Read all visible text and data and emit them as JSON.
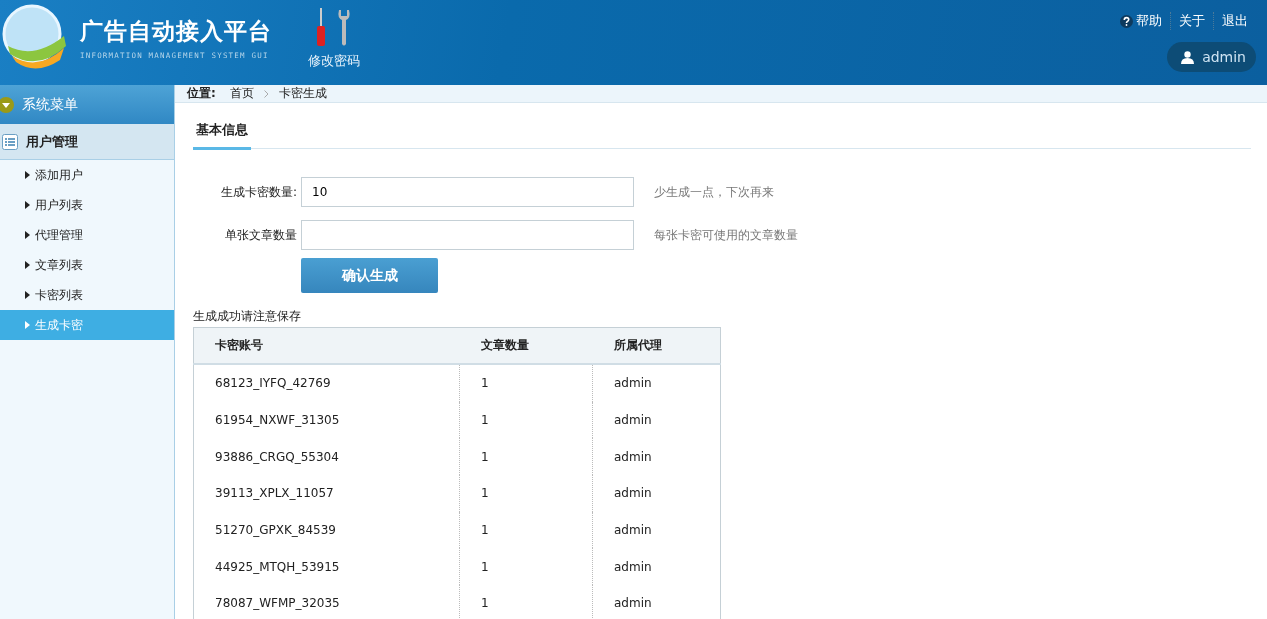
{
  "header": {
    "title": "广告自动接入平台",
    "subtitle": "INFORMATION MANAGEMENT SYSTEM GUI",
    "tool": {
      "label": "修改密码"
    },
    "links": [
      {
        "kind": "help",
        "label": "帮助"
      },
      {
        "kind": "plain",
        "label": "关于"
      },
      {
        "kind": "plain",
        "label": "退出"
      }
    ],
    "user": "admin"
  },
  "sidebar": {
    "title": "系统菜单",
    "group": {
      "label": "用户管理",
      "items": [
        {
          "label": "添加用户",
          "selected": false
        },
        {
          "label": "用户列表",
          "selected": false
        },
        {
          "label": "代理管理",
          "selected": false
        },
        {
          "label": "文章列表",
          "selected": false
        },
        {
          "label": "卡密列表",
          "selected": false
        },
        {
          "label": "生成卡密",
          "selected": true
        }
      ]
    }
  },
  "breadcrumb": {
    "label": "位置:",
    "items": [
      "首页",
      "卡密生成"
    ]
  },
  "tab": "基本信息",
  "form": {
    "fields": [
      {
        "label": "生成卡密数量:",
        "value": "10",
        "hint": "少生成一点，下次再来"
      },
      {
        "label": "单张文章数量",
        "hint": "每张卡密可使用的文章数量"
      }
    ],
    "submit": "确认生成"
  },
  "result": {
    "note": "生成成功请注意保存",
    "columns": [
      "卡密账号",
      "文章数量",
      "所属代理"
    ],
    "rows": [
      [
        "68123_IYFQ_42769",
        "1",
        "admin"
      ],
      [
        "61954_NXWF_31305",
        "1",
        "admin"
      ],
      [
        "93886_CRGQ_55304",
        "1",
        "admin"
      ],
      [
        "39113_XPLX_11057",
        "1",
        "admin"
      ],
      [
        "51270_GPXK_84539",
        "1",
        "admin"
      ],
      [
        "44925_MTQH_53915",
        "1",
        "admin"
      ],
      [
        "78087_WFMP_32035",
        "1",
        "admin"
      ]
    ]
  }
}
